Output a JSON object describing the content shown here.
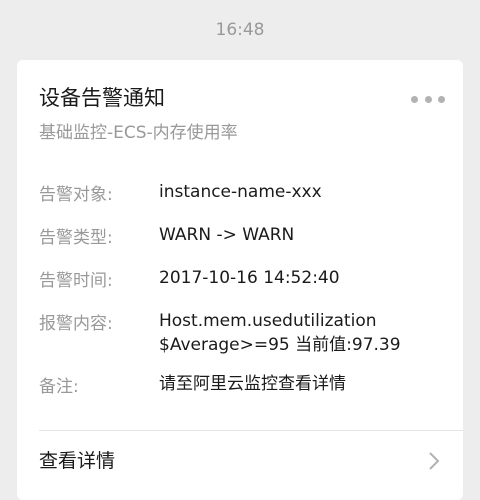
{
  "timestamp": "16:48",
  "card": {
    "title": "设备告警通知",
    "subtitle": "基础监控-ECS-内存使用率",
    "more_icon": "more-horizontal-icon",
    "fields": [
      {
        "label": "告警对象:",
        "value": "instance-name-xxx"
      },
      {
        "label": "告警类型:",
        "value": "WARN -> WARN"
      },
      {
        "label": "告警时间:",
        "value": "2017-10-16 14:52:40"
      },
      {
        "label": "报警内容:",
        "value": "Host.mem.usedutilization $Average>=95 当前值:97.39"
      },
      {
        "label": "备注:",
        "value": "请至阿里云监控查看详情"
      }
    ],
    "details_label": "查看详情",
    "details_icon": "chevron-right-icon"
  },
  "colors": {
    "background": "#ededed",
    "card": "#ffffff",
    "primary_text": "#1a1a1a",
    "secondary_text": "#999999",
    "icon": "#b2b2b2"
  }
}
